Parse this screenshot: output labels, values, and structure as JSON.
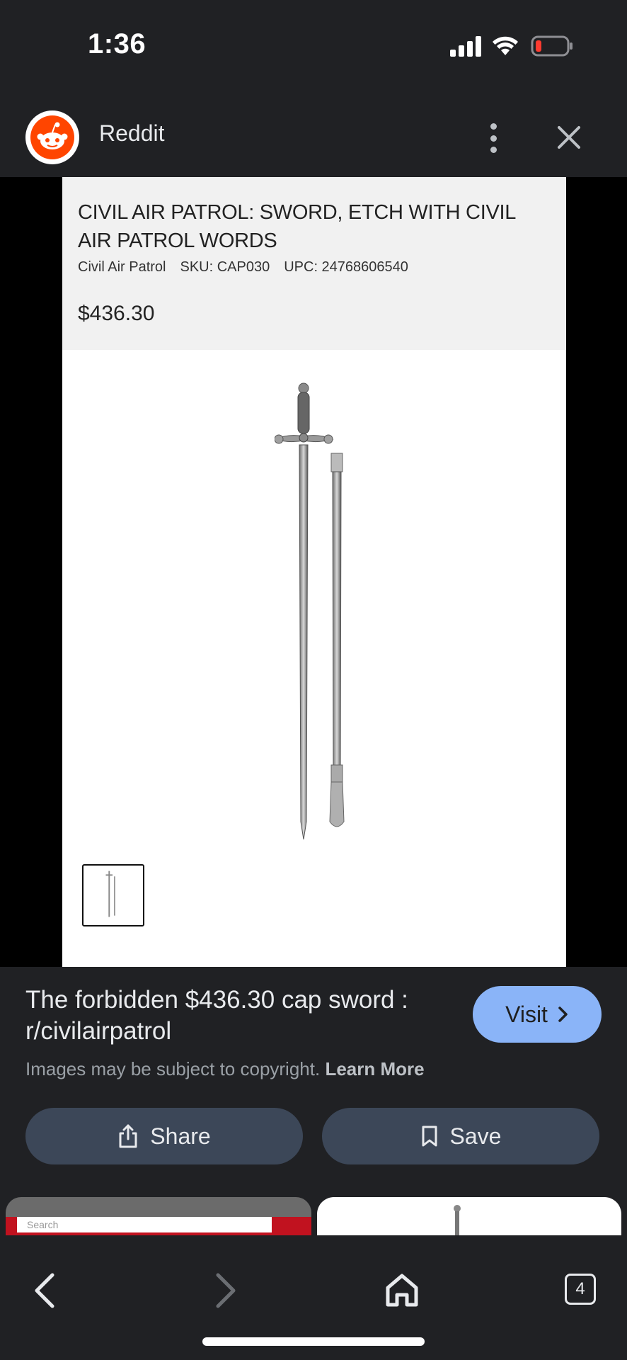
{
  "status_bar": {
    "time": "1:36"
  },
  "header": {
    "site_name": "Reddit",
    "logo_icon": "reddit-snoo-icon"
  },
  "product_page": {
    "title": "CIVIL AIR PATROL: SWORD, ETCH WITH CIVIL AIR PATROL WORDS",
    "brand": "Civil Air Patrol",
    "sku": "SKU: CAP030",
    "upc": "UPC: 24768606540",
    "price": "$436.30"
  },
  "result": {
    "title": "The forbidden $436.30 cap sword : r/civilairpatrol",
    "visit_label": "Visit",
    "copyright_text": "Images may be subject to copyright.",
    "learn_more_label": "Learn More"
  },
  "actions": {
    "share_label": "Share",
    "save_label": "Save"
  },
  "related": {
    "search_placeholder": "Search"
  },
  "bottom_nav": {
    "tab_count": "4"
  },
  "colors": {
    "background": "#202124",
    "accent": "#8ab4f8",
    "button": "#3c4758",
    "reddit": "#ff4500"
  }
}
